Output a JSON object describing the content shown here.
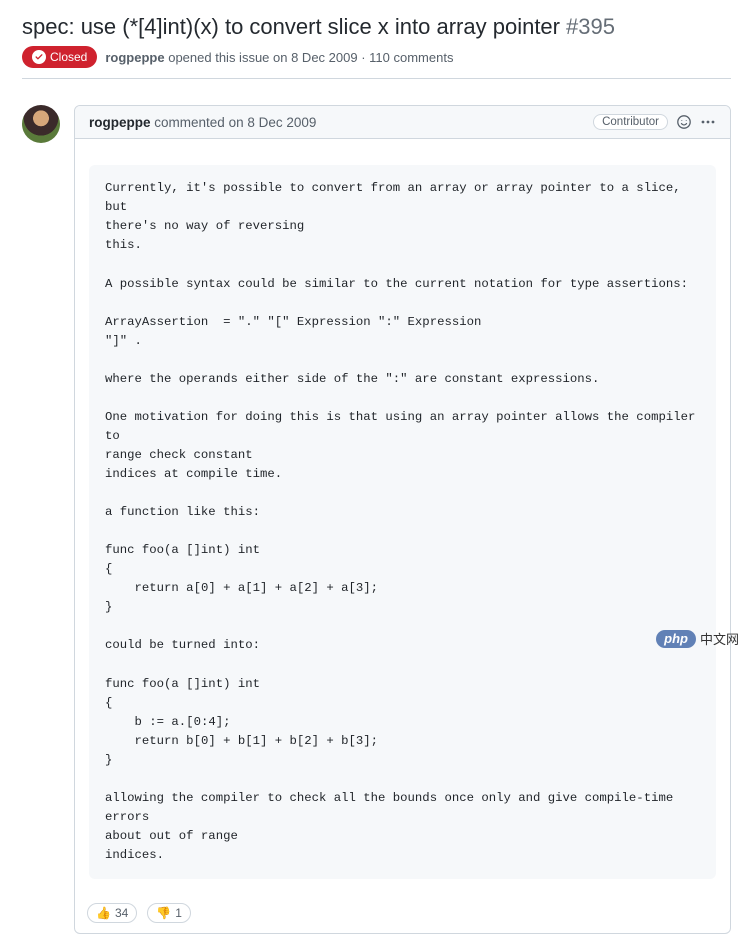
{
  "issue": {
    "title": "spec: use (*[4]int)(x) to convert slice x into array pointer",
    "number": "#395",
    "state_label": "Closed",
    "author": "rogpeppe",
    "opened_text": "opened this issue on 8 Dec 2009",
    "comment_count_text": "110 comments"
  },
  "comment": {
    "author": "rogpeppe",
    "timestamp_text": "commented on 8 Dec 2009",
    "role_badge": "Contributor",
    "body": "Currently, it's possible to convert from an array or array pointer to a slice, but\nthere's no way of reversing\nthis.\n\nA possible syntax could be similar to the current notation for type assertions:\n\nArrayAssertion  = \".\" \"[\" Expression \":\" Expression\n\"]\" .\n\nwhere the operands either side of the \":\" are constant expressions.\n\nOne motivation for doing this is that using an array pointer allows the compiler to\nrange check constant\nindices at compile time.\n\na function like this:\n\nfunc foo(a []int) int\n{\n    return a[0] + a[1] + a[2] + a[3];\n}\n\ncould be turned into:\n\nfunc foo(a []int) int\n{\n    b := a.[0:4];\n    return b[0] + b[1] + b[2] + b[3];\n}\n\nallowing the compiler to check all the bounds once only and give compile-time errors\nabout out of range\nindices.",
    "reactions": {
      "thumbs_up": {
        "emoji": "👍",
        "count": "34"
      },
      "thumbs_down": {
        "emoji": "👎",
        "count": "1"
      }
    }
  },
  "watermark": {
    "logo": "php",
    "text": "中文网"
  }
}
